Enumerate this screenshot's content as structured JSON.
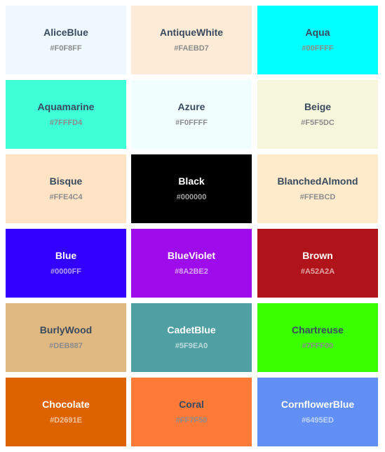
{
  "swatches": [
    {
      "name": "AliceBlue",
      "hex": "#F0F8FF",
      "text_tone": "dark"
    },
    {
      "name": "AntiqueWhite",
      "hex": "#FAEBD7",
      "text_tone": "dark"
    },
    {
      "name": "Aqua",
      "hex": "#00FFFF",
      "text_tone": "dark"
    },
    {
      "name": "Aquamarine",
      "hex": "#7FFFD4",
      "text_tone": "dark"
    },
    {
      "name": "Azure",
      "hex": "#F0FFFF",
      "text_tone": "dark"
    },
    {
      "name": "Beige",
      "hex": "#F5F5DC",
      "text_tone": "dark"
    },
    {
      "name": "Bisque",
      "hex": "#FFE4C4",
      "text_tone": "dark"
    },
    {
      "name": "Black",
      "hex": "#000000",
      "text_tone": "light"
    },
    {
      "name": "BlanchedAlmond",
      "hex": "#FFEBCD",
      "text_tone": "dark"
    },
    {
      "name": "Blue",
      "hex": "#0000FF",
      "text_tone": "light"
    },
    {
      "name": "BlueViolet",
      "hex": "#8A2BE2",
      "text_tone": "light"
    },
    {
      "name": "Brown",
      "hex": "#A52A2A",
      "text_tone": "light"
    },
    {
      "name": "BurlyWood",
      "hex": "#DEB887",
      "text_tone": "dark"
    },
    {
      "name": "CadetBlue",
      "hex": "#5F9EA0",
      "text_tone": "light"
    },
    {
      "name": "Chartreuse",
      "hex": "#7FFF00",
      "text_tone": "dark"
    },
    {
      "name": "Chocolate",
      "hex": "#D2691E",
      "text_tone": "light"
    },
    {
      "name": "Coral",
      "hex": "#FF7F50",
      "text_tone": "dark"
    },
    {
      "name": "CornflowerBlue",
      "hex": "#6495ED",
      "text_tone": "light"
    }
  ],
  "displayed_colors": [
    "#EFF8FE",
    "#FCEBD6",
    "#00FFFF",
    "#3FFFD6",
    "#F0FFFE",
    "#F5F6DC",
    "#FEE4C4",
    "#000000",
    "#FEEBCC",
    "#3200FF",
    "#9E0CEB",
    "#B0131A",
    "#E0B982",
    "#4F9FA3",
    "#3AFF00",
    "#DC6300",
    "#FE7A39",
    "#618FF4"
  ]
}
